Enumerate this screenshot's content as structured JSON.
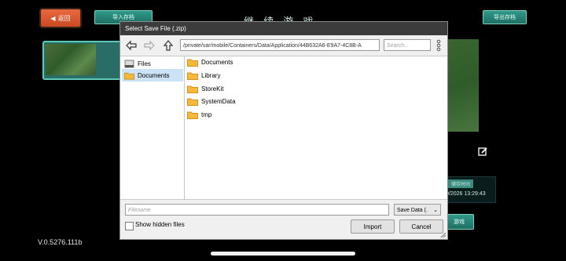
{
  "game": {
    "back_label": "返回",
    "import_label": "导入存档",
    "title": "继 续 游 戏",
    "export_label": "导出存档",
    "save_time_label": "储存时间",
    "save_time_value": "0/2026 13:29:43",
    "continue_label": "游戏",
    "version": "V.0.5276.111b"
  },
  "dialog": {
    "title": "Select Save File (.zip)",
    "path": "/private/var/mobile/Containers/Data/Application/44B632A6-E9A7-4C8B-A",
    "search_placeholder": "Search...",
    "sidebar": [
      {
        "label": "Files",
        "icon": "drive-icon",
        "selected": false
      },
      {
        "label": "Documents",
        "icon": "folder-icon",
        "selected": true
      }
    ],
    "folders": [
      "Documents",
      "Library",
      "StoreKit",
      "SystemData",
      "tmp"
    ],
    "filename_placeholder": "Filename",
    "file_type": "Save Data (.",
    "show_hidden_label": "Show hidden files",
    "import_button": "Import",
    "cancel_button": "Cancel"
  },
  "colors": {
    "accent_orange": "#d9582e",
    "accent_teal": "#2f9a8a",
    "folder": "#f5b83a",
    "selection": "#cce3f7"
  }
}
